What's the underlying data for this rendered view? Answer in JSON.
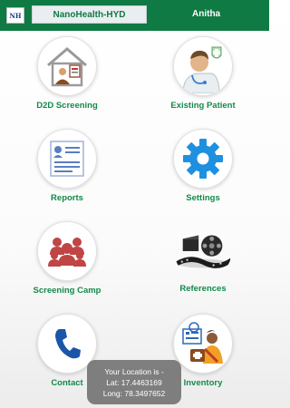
{
  "header": {
    "logo_text": "NH",
    "org_name": "NanoHealth-HYD",
    "user_name": "Anitha",
    "bar_color": "#0f7a43"
  },
  "tiles": [
    {
      "label": "D2D Screening",
      "icon": "house-family-icon"
    },
    {
      "label": "Existing Patient",
      "icon": "doctor-patient-icon"
    },
    {
      "label": "Reports",
      "icon": "report-document-icon"
    },
    {
      "label": "Settings",
      "icon": "gear-icon"
    },
    {
      "label": "Screening Camp",
      "icon": "people-group-icon"
    },
    {
      "label": "References",
      "icon": "film-reel-icon"
    },
    {
      "label": "Contact",
      "icon": "phone-icon"
    },
    {
      "label": "Inventory",
      "icon": "health-worker-kit-icon"
    }
  ],
  "toast": {
    "line1": "Your Location is -",
    "line2": "Lat: 17.4463169",
    "line3": "Long: 78.3497652"
  },
  "colors": {
    "accent": "#128a4a",
    "settings_gear": "#1e90e0",
    "group_red": "#c04545"
  }
}
